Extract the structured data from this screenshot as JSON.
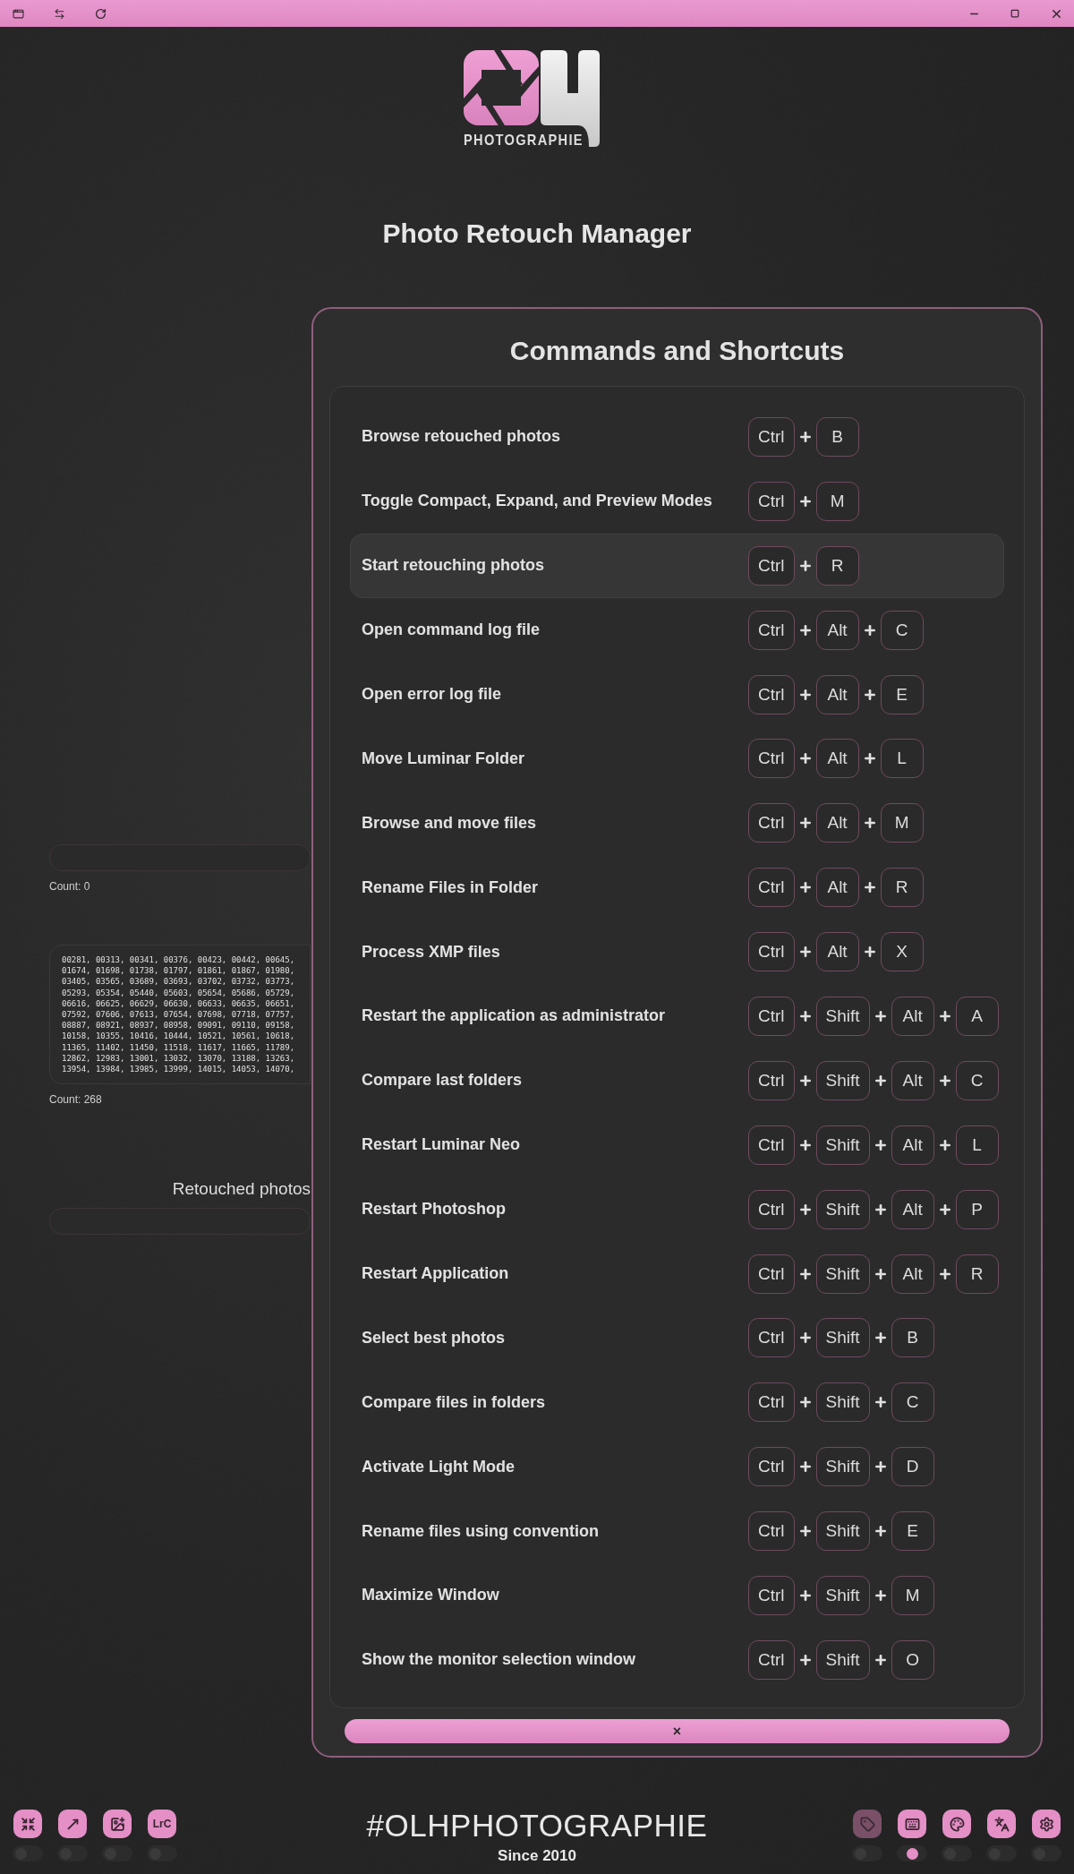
{
  "logo": {
    "wordmark": "PHOTOGRAPHIE"
  },
  "app_title": "Photo Retouch Manager",
  "background": {
    "count_retouched": "Count: 0",
    "pending_numbers": [
      "00281, 00313, 00341, 00376, 00423, 00442, 00645,",
      "01674, 01698, 01738, 01797, 01861, 01867, 01980,",
      "03405, 03565, 03689, 03693, 03702, 03732, 03773,",
      "05293, 05354, 05440, 05603, 05654, 05686, 05729,",
      "06616, 06625, 06629, 06630, 06633, 06635, 06651,",
      "07592, 07606, 07613, 07654, 07698, 07718, 07757,",
      "08887, 08921, 08937, 08958, 09091, 09110, 09158,",
      "10158, 10355, 10416, 10444, 10521, 10561, 10618,",
      "11365, 11402, 11450, 11518, 11617, 11665, 11789,",
      "12862, 12983, 13001, 13032, 13070, 13188, 13263,",
      "13954, 13984, 13985, 13999, 14015, 14053, 14070,"
    ],
    "count_pending": "Count: 268",
    "retouched_label": "Retouched photos"
  },
  "modal": {
    "title": "Commands and Shortcuts",
    "shortcuts": [
      {
        "label": "Browse retouched photos",
        "keys": [
          "Ctrl",
          "B"
        ],
        "highlighted": false
      },
      {
        "label": "Toggle Compact, Expand, and Preview Modes",
        "keys": [
          "Ctrl",
          "M"
        ],
        "highlighted": false
      },
      {
        "label": "Start retouching photos",
        "keys": [
          "Ctrl",
          "R"
        ],
        "highlighted": true
      },
      {
        "label": "Open command log file",
        "keys": [
          "Ctrl",
          "Alt",
          "C"
        ],
        "highlighted": false
      },
      {
        "label": "Open error log file",
        "keys": [
          "Ctrl",
          "Alt",
          "E"
        ],
        "highlighted": false
      },
      {
        "label": "Move Luminar Folder",
        "keys": [
          "Ctrl",
          "Alt",
          "L"
        ],
        "highlighted": false
      },
      {
        "label": "Browse and move files",
        "keys": [
          "Ctrl",
          "Alt",
          "M"
        ],
        "highlighted": false
      },
      {
        "label": "Rename Files in Folder",
        "keys": [
          "Ctrl",
          "Alt",
          "R"
        ],
        "highlighted": false
      },
      {
        "label": "Process XMP files",
        "keys": [
          "Ctrl",
          "Alt",
          "X"
        ],
        "highlighted": false
      },
      {
        "label": "Restart the application as administrator",
        "keys": [
          "Ctrl",
          "Shift",
          "Alt",
          "A"
        ],
        "highlighted": false
      },
      {
        "label": "Compare last folders",
        "keys": [
          "Ctrl",
          "Shift",
          "Alt",
          "C"
        ],
        "highlighted": false
      },
      {
        "label": "Restart Luminar Neo",
        "keys": [
          "Ctrl",
          "Shift",
          "Alt",
          "L"
        ],
        "highlighted": false
      },
      {
        "label": "Restart Photoshop",
        "keys": [
          "Ctrl",
          "Shift",
          "Alt",
          "P"
        ],
        "highlighted": false
      },
      {
        "label": "Restart Application",
        "keys": [
          "Ctrl",
          "Shift",
          "Alt",
          "R"
        ],
        "highlighted": false
      },
      {
        "label": "Select best photos",
        "keys": [
          "Ctrl",
          "Shift",
          "B"
        ],
        "highlighted": false
      },
      {
        "label": "Compare files in folders",
        "keys": [
          "Ctrl",
          "Shift",
          "C"
        ],
        "highlighted": false
      },
      {
        "label": "Activate Light Mode",
        "keys": [
          "Ctrl",
          "Shift",
          "D"
        ],
        "highlighted": false
      },
      {
        "label": "Rename files using convention",
        "keys": [
          "Ctrl",
          "Shift",
          "E"
        ],
        "highlighted": false
      },
      {
        "label": "Maximize Window",
        "keys": [
          "Ctrl",
          "Shift",
          "M"
        ],
        "highlighted": false
      },
      {
        "label": "Show the monitor selection window",
        "keys": [
          "Ctrl",
          "Shift",
          "O"
        ],
        "highlighted": false
      }
    ],
    "close": "×"
  },
  "footer": {
    "left_tools": [
      {
        "kind": "icon",
        "on": false
      },
      {
        "kind": "icon",
        "on": false
      },
      {
        "kind": "icon",
        "on": false
      },
      {
        "kind": "text",
        "text": "LrC",
        "on": false
      }
    ],
    "brand": "#OLHPHOTOGRAPHIE",
    "since": "Since 2010",
    "right_tools": [
      {
        "on": false,
        "disabled": true
      },
      {
        "on": true,
        "disabled": false
      },
      {
        "on": false,
        "disabled": false
      },
      {
        "on": false,
        "disabled": false
      },
      {
        "on": false,
        "disabled": false
      }
    ]
  }
}
